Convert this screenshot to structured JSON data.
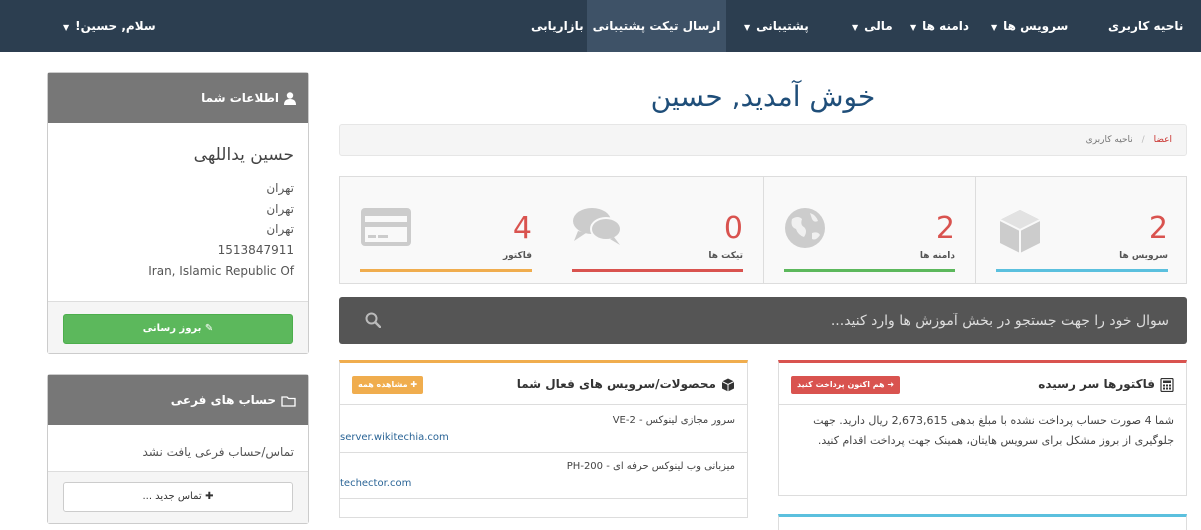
{
  "nav": {
    "user_area": "ناحیه کاربری",
    "services": "سرویس ها",
    "domains": "دامنه ها",
    "billing": "مالی",
    "support": "پشتیبانی",
    "open_ticket": "ارسال تیکت پشتیبانی",
    "affiliates": "بازاریابی",
    "greeting": "سلام, حسین!"
  },
  "profile": {
    "title": "اطلاعات شما",
    "name": "حسین یداللهی",
    "line1": "تهران",
    "line2": "تهران",
    "line3": "تهران",
    "postcode": "1513847911",
    "country": "Iran, Islamic Republic Of",
    "update_button": "بروز رسانی"
  },
  "contacts": {
    "title": "حساب های فرعی",
    "empty": "تماس/حساب فرعی یافت نشد",
    "new_button": "تماس جدید ..."
  },
  "main": {
    "welcome": "خوش آمدید, حسین",
    "breadcrumb_home": "اعضا",
    "breadcrumb_sep": "/",
    "breadcrumb_current": "ناحیه کاربری"
  },
  "stats": [
    {
      "label": "سرویس ها",
      "count": "2",
      "color": "#5bc0de"
    },
    {
      "label": "دامنه ها",
      "count": "2",
      "color": "#5cb85c"
    },
    {
      "label": "تیکت ها",
      "count": "0",
      "color": "#d9534f"
    },
    {
      "label": "فاکتور",
      "count": "4",
      "color": "#f0ad4e"
    }
  ],
  "search": {
    "placeholder": "سوال خود را جهت جستجو در بخش آموزش ها وارد کنید..."
  },
  "invoices": {
    "title": "فاکتورها سر رسیده",
    "pay_button": "هم اکنون پرداخت کنید",
    "text": "شما 4 صورت حساب پرداخت نشده با مبلغ بدهی 2,673,615 ریال دارید. جهت جلوگیری از بروز مشکل برای سرویس هایتان، همینک جهت پرداخت اقدام کنید.",
    "accent": "#d9534f"
  },
  "products": {
    "title": "محصولات/سرویس های فعال شما",
    "view_all": "مشاهده همه",
    "accent": "#f0ad4e",
    "items": [
      {
        "name": "سرور مجازی لینوکس - VE-2",
        "domain": "server.wikitechia.com"
      },
      {
        "name": "میزبانی وب لینوکس حرفه ای - PH-200",
        "domain": "techector.com"
      }
    ]
  }
}
